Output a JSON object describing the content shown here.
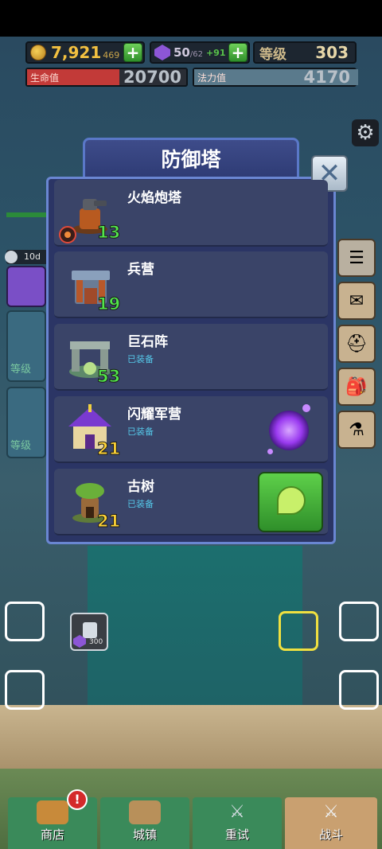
{
  "resources": {
    "gold_main": "7,921",
    "gold_sub": "469",
    "gems": "50",
    "gems_max": "/62",
    "gems_bonus": "+91",
    "level_label": "等级",
    "level_value": "303",
    "plus": "+"
  },
  "stats": {
    "hp_label": "生命值",
    "hp_value": "20700",
    "mp_label": "法力值",
    "mp_value": "4170"
  },
  "hero": {
    "days": "10d"
  },
  "side_cards": {
    "label1": "等级",
    "label2": "等级"
  },
  "dialog": {
    "title": "防御塔",
    "close": "✕",
    "rows": [
      {
        "name": "火焰炮塔",
        "status": "",
        "count": "13"
      },
      {
        "name": "兵营",
        "status": "",
        "count": "19"
      },
      {
        "name": "巨石阵",
        "status": "已装备",
        "count": "53"
      },
      {
        "name": "闪耀军营",
        "status": "已装备",
        "count": "21"
      },
      {
        "name": "古树",
        "status": "已装备",
        "count": "21"
      }
    ]
  },
  "lock": {
    "cost": "300"
  },
  "nav": {
    "shop": "商店",
    "town": "城镇",
    "retry": "重试",
    "battle": "战斗",
    "alert": "!"
  },
  "colors": {
    "dialog_bg": "#2b3565",
    "dialog_border": "#6a86d2",
    "count_green": "#52e64a",
    "count_yellow": "#ffd436",
    "equipped": "#55c7e8"
  },
  "icons": [
    "coin-icon",
    "gem-icon",
    "gear-icon",
    "close-icon",
    "menu-icon",
    "mail-icon",
    "helmet-icon",
    "backpack-icon",
    "potion-icon",
    "lock-icon",
    "chest-icon",
    "sword-icon"
  ]
}
